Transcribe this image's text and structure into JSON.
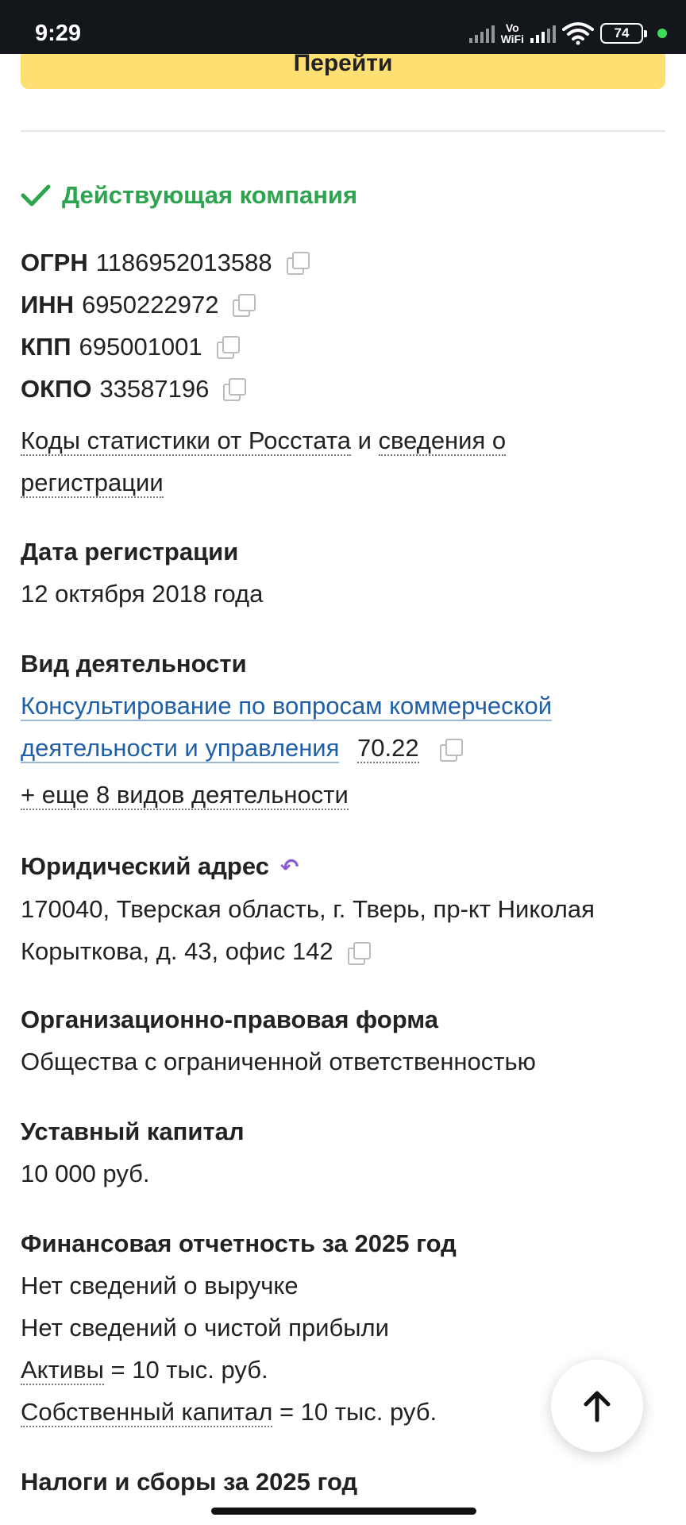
{
  "status_bar": {
    "time": "9:29",
    "vo": "Vo",
    "wifi_label": "WiFi",
    "battery": "74"
  },
  "header": {
    "go_button_label": "Перейти"
  },
  "company": {
    "status": "Действующая компания",
    "codes": [
      {
        "key": "ОГРН",
        "value": "1186952013588"
      },
      {
        "key": "ИНН",
        "value": "6950222972"
      },
      {
        "key": "КПП",
        "value": "695001001"
      },
      {
        "key": "ОКПО",
        "value": "33587196"
      }
    ],
    "rosstat_link": "Коды статистики от Росстата",
    "rosstat_and": "и",
    "registration_link_part1": "сведения о",
    "registration_link_part2": "регистрации",
    "reg_date_title": "Дата регистрации",
    "reg_date": "12 октября 2018 года",
    "activity_title": "Вид деятельности",
    "activity_line1": "Консультирование по вопросам коммерческой",
    "activity_line2": "деятельности и управления",
    "activity_code": "70.22",
    "activity_more": "+ еще 8 видов деятельности",
    "address_title": "Юридический адрес",
    "address_line1": "170040, Тверская область, г. Тверь, пр-кт Николая",
    "address_line2": "Корыткова, д. 43, офис 142",
    "legal_form_title": "Организационно-правовая форма",
    "legal_form": "Общества с ограниченной ответственностью",
    "capital_title": "Уставный капитал",
    "capital": "10 000 руб.",
    "finance_title": "Финансовая отчетность за 2025 год",
    "finance_revenue": "Нет сведений о выручке",
    "finance_profit": "Нет сведений о чистой прибыли",
    "finance_assets_label": "Активы",
    "finance_assets_value": "= 10 тыс. руб.",
    "finance_equity_label": "Собственный капитал",
    "finance_equity_value": "= 10 тыс. руб.",
    "taxes_title": "Налоги и сборы за 2025 год"
  },
  "colors": {
    "accent_yellow": "#fedf72",
    "status_green": "#2ea44f",
    "link_blue": "#1f5fa8",
    "history_purple": "#8a5cd0"
  },
  "icons": [
    "check-icon",
    "copy-icon",
    "history-icon",
    "arrow-up-icon"
  ]
}
